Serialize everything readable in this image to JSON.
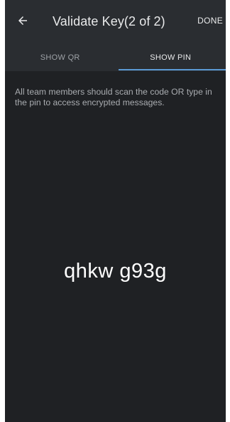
{
  "header": {
    "title": "Validate Key(2 of 2)",
    "done_label": "DONE"
  },
  "tabs": [
    {
      "label": "SHOW QR",
      "active": false
    },
    {
      "label": "SHOW PIN",
      "active": true
    }
  ],
  "info_text": "All team members should scan the code OR type in the pin to access encrypted messages.",
  "pin": "qhkw g93g",
  "colors": {
    "background": "#1f2124",
    "appbar": "#2a2d31",
    "tab_indicator": "#5b9bd6"
  },
  "icons": {
    "back": "back-arrow-icon"
  }
}
